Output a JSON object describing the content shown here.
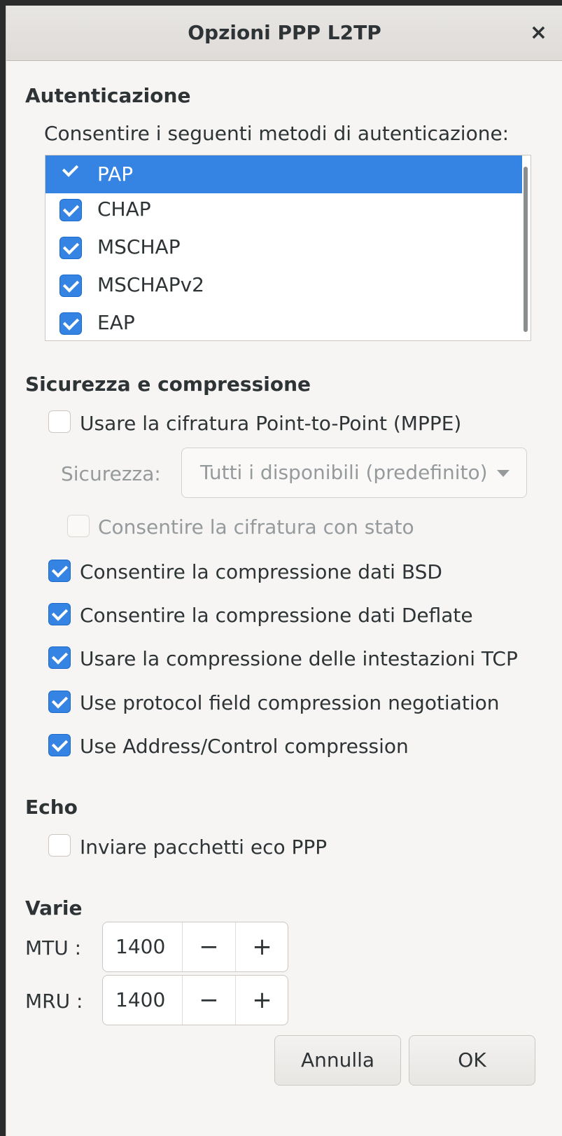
{
  "window": {
    "title": "Opzioni PPP L2TP",
    "close_glyph": "×"
  },
  "auth": {
    "heading": "Autenticazione",
    "description": "Consentire i seguenti metodi di autenticazione:",
    "methods": [
      {
        "label": "PAP",
        "checked": true,
        "selected": true
      },
      {
        "label": "CHAP",
        "checked": true,
        "selected": false
      },
      {
        "label": "MSCHAP",
        "checked": true,
        "selected": false
      },
      {
        "label": "MSCHAPv2",
        "checked": true,
        "selected": false
      },
      {
        "label": "EAP",
        "checked": true,
        "selected": false
      }
    ]
  },
  "security": {
    "heading": "Sicurezza e compressione",
    "mppe_label": "Usare la cifratura Point-to-Point (MPPE)",
    "mppe_checked": false,
    "security_label": "Sicurezza:",
    "security_value": "Tutti i disponibili (predefinito)",
    "stateful_label": "Consentire la cifratura con stato",
    "stateful_checked": false,
    "options": [
      {
        "label": "Consentire la compressione dati BSD",
        "checked": true
      },
      {
        "label": "Consentire la compressione dati Deflate",
        "checked": true
      },
      {
        "label": "Usare la compressione delle intestazioni TCP",
        "checked": true
      },
      {
        "label": "Use protocol field compression negotiation",
        "checked": true
      },
      {
        "label": "Use Address/Control compression",
        "checked": true
      }
    ]
  },
  "echo": {
    "heading": "Echo",
    "send_label": "Inviare pacchetti eco PPP",
    "send_checked": false
  },
  "misc": {
    "heading": "Varie",
    "mtu_label": "MTU :",
    "mtu_value": "1400",
    "mru_label": "MRU :",
    "mru_value": "1400",
    "minus_glyph": "−",
    "plus_glyph": "+"
  },
  "buttons": {
    "cancel": "Annulla",
    "ok": "OK"
  },
  "colors": {
    "accent": "#3584e4",
    "background": "#f6f5f4",
    "text": "#2e3436",
    "disabled_text": "#959a9c"
  }
}
